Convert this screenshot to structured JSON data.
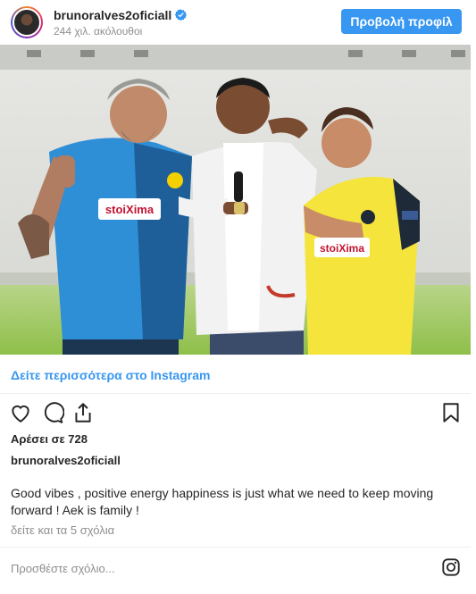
{
  "header": {
    "username": "brunoralves2oficiall",
    "followers": "244 χιλ. ακόλουθοι",
    "profile_button": "Προβολή προφίλ",
    "accent": "#3897f0"
  },
  "post": {
    "view_more": "Δείτε περισσότερα στο Instagram",
    "likes": "Αρέσει σε 728",
    "caption_user": "brunoralves2oficiall",
    "caption": "Good vibes , positive energy happiness is just what we need to keep moving forward ! Aek is family !",
    "comments_link": "δείτε και τα 5 σχόλια",
    "add_comment_placeholder": "Προσθέστε σχόλιο...",
    "shirt_sponsor": "stoiXima"
  },
  "icons": {
    "like": "heart-icon",
    "comment": "comment-icon",
    "share": "share-icon",
    "save": "bookmark-icon",
    "instagram": "instagram-logo-icon",
    "verified": "verified-badge-icon"
  }
}
